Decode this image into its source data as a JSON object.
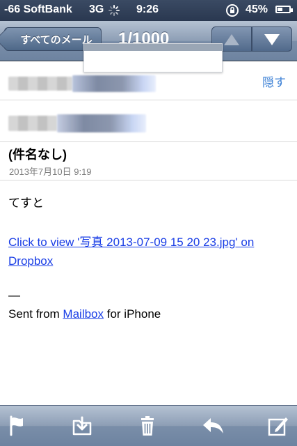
{
  "status_bar": {
    "carrier": "-66 SoftBank",
    "network": "3G",
    "time": "9:26",
    "battery": "45%",
    "battery_level": 0.45
  },
  "nav": {
    "back_label": "すべてのメール",
    "title": "1/1000"
  },
  "header": {
    "hide_label": "隠す"
  },
  "message": {
    "subject": "(件名なし)",
    "date": "2013年7月10日 9:19",
    "body_line1": "てすと",
    "link_text": "Click to view '写真 2013-07-09 15 20 23.jpg' on Dropbox",
    "signature_dash": "—",
    "sent_from_prefix": "Sent from ",
    "sent_from_link": "Mailbox",
    "sent_from_suffix": " for iPhone"
  },
  "toolbar": {
    "icons": [
      "flag-icon",
      "move-folder-icon",
      "trash-icon",
      "reply-icon",
      "compose-icon"
    ]
  },
  "colors": {
    "accent_link": "#1a3ee6",
    "hide_link": "#3a7fd5",
    "nav_bar": "#8d9eb5"
  }
}
